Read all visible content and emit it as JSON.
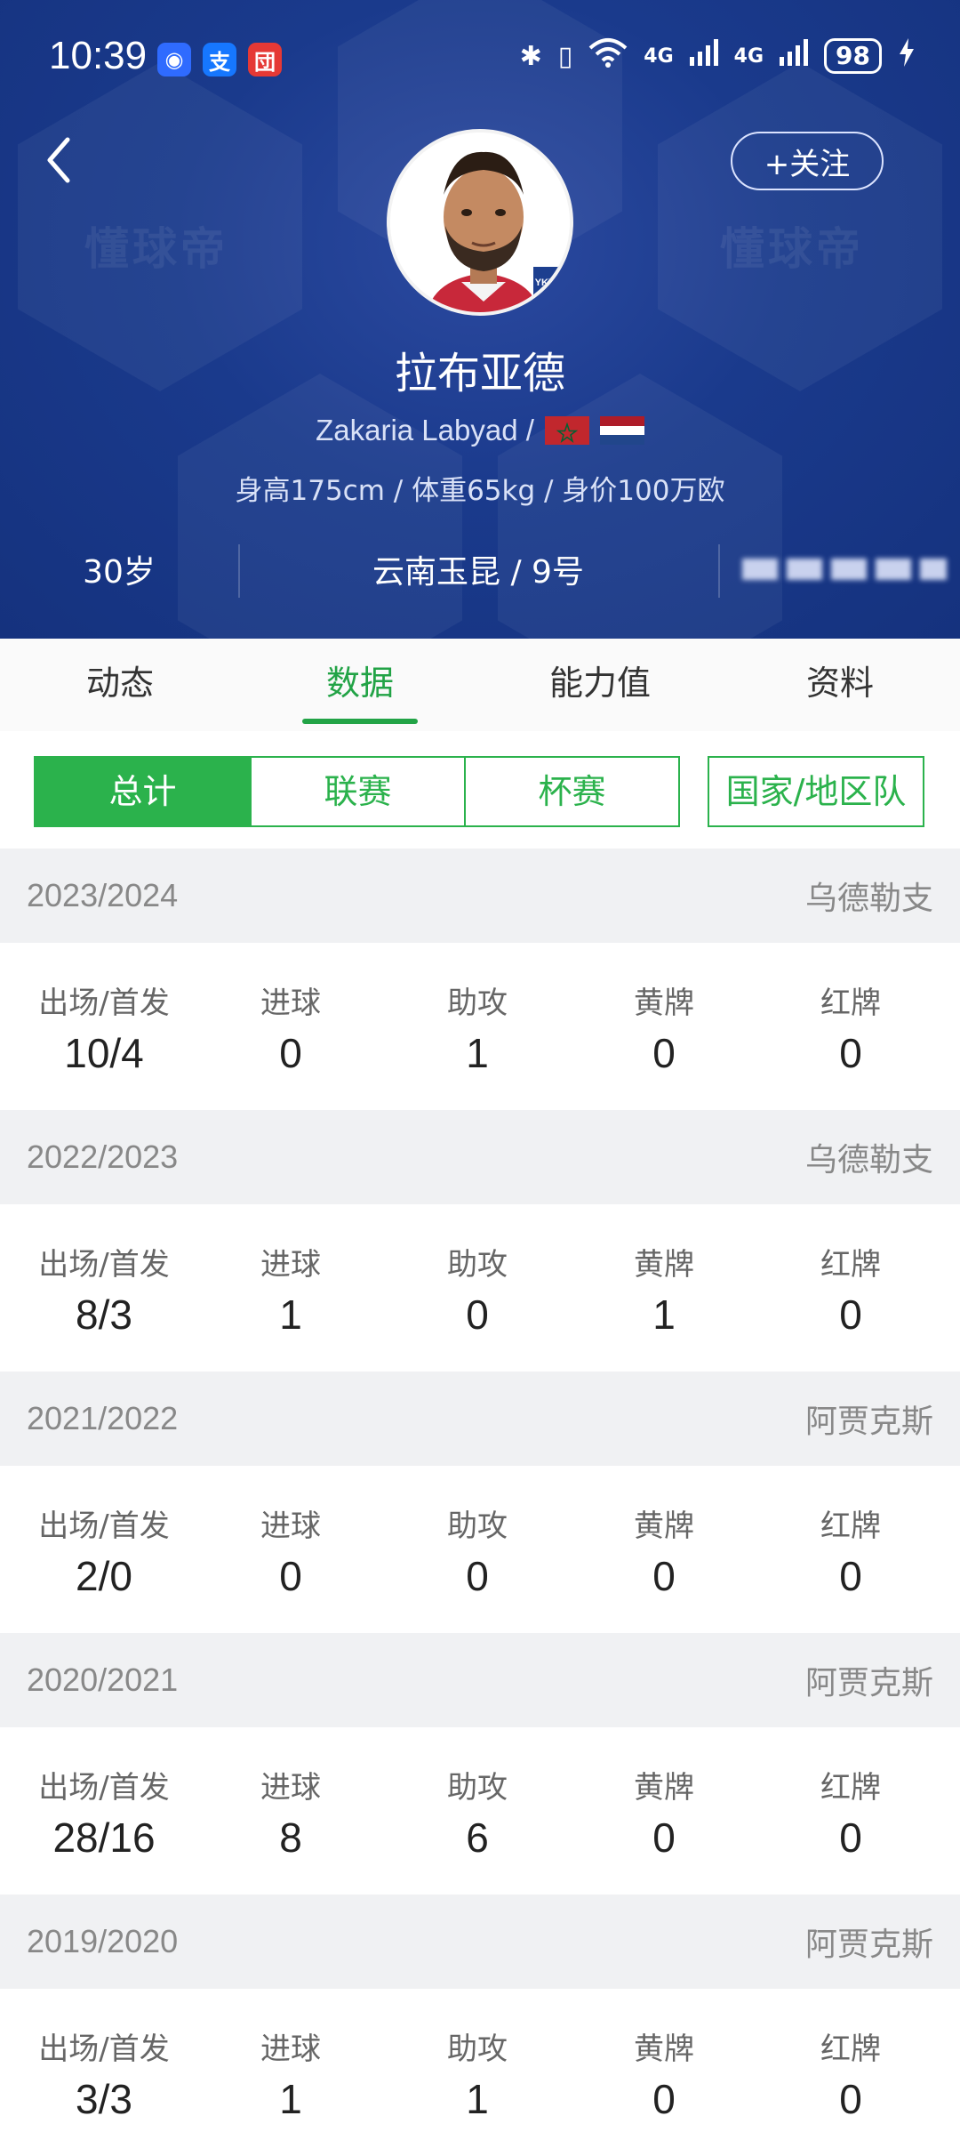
{
  "status_bar": {
    "time": "10:39",
    "apps": [
      {
        "icon": "app-shield-icon",
        "glyph": "◉",
        "color": "#2f6bff"
      },
      {
        "icon": "alipay-icon",
        "glyph": "支",
        "color": "#1677ff"
      },
      {
        "icon": "app-red-icon",
        "glyph": "団",
        "color": "#e53935"
      }
    ],
    "bluetooth": "✱",
    "vibrate": "▯",
    "wifi": "◠",
    "network1": "4G",
    "network2": "4G",
    "battery": "98"
  },
  "header": {
    "back": "‹",
    "follow": "+关注",
    "watermark": "懂球帝",
    "club_badge": "YKYK",
    "player_name": "拉布亚德",
    "english_name": "Zakaria Labyad /",
    "flags": [
      "morocco-flag",
      "netherlands-flag"
    ],
    "body_info": "身高175cm / 体重65kg / 身价100万欧",
    "age": "30岁",
    "club": "云南玉昆 / 9号"
  },
  "tabs": [
    {
      "label": "动态",
      "active": false
    },
    {
      "label": "数据",
      "active": true
    },
    {
      "label": "能力值",
      "active": false
    },
    {
      "label": "资料",
      "active": false
    }
  ],
  "filters": {
    "total": "总计",
    "league": "联赛",
    "cup": "杯赛",
    "national": "国家/地区队"
  },
  "stat_labels": {
    "apps": "出场/首发",
    "goals": "进球",
    "assists": "助攻",
    "yellow": "黄牌",
    "red": "红牌"
  },
  "seasons": [
    {
      "year": "2023/2024",
      "club": "乌德勒支",
      "apps": "10/4",
      "goals": "0",
      "assists": "1",
      "yellow": "0",
      "red": "0"
    },
    {
      "year": "2022/2023",
      "club": "乌德勒支",
      "apps": "8/3",
      "goals": "1",
      "assists": "0",
      "yellow": "1",
      "red": "0"
    },
    {
      "year": "2021/2022",
      "club": "阿贾克斯",
      "apps": "2/0",
      "goals": "0",
      "assists": "0",
      "yellow": "0",
      "red": "0"
    },
    {
      "year": "2020/2021",
      "club": "阿贾克斯",
      "apps": "28/16",
      "goals": "8",
      "assists": "6",
      "yellow": "0",
      "red": "0"
    },
    {
      "year": "2019/2020",
      "club": "阿贾克斯",
      "apps": "3/3",
      "goals": "1",
      "assists": "1",
      "yellow": "0",
      "red": "0"
    }
  ]
}
